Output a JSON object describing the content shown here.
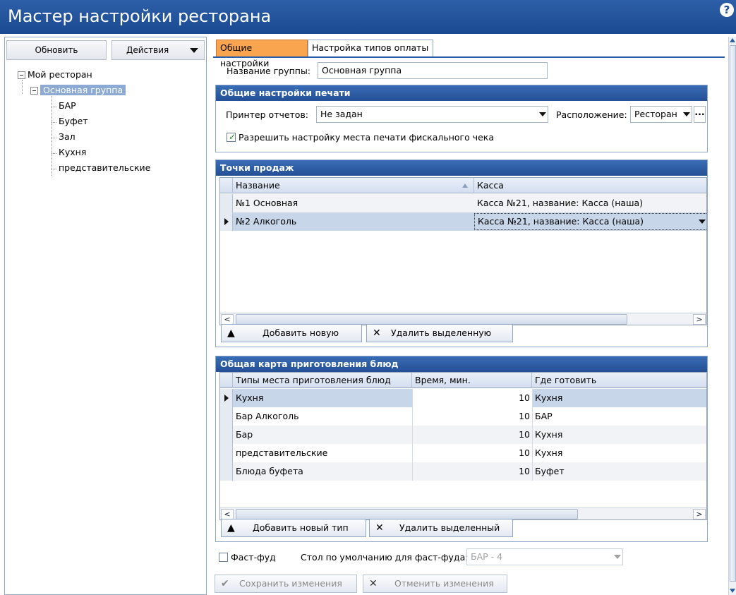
{
  "window": {
    "title": "Мастер настройки ресторана"
  },
  "toolbar": {
    "refresh_label": "Обновить",
    "actions_label": "Действия"
  },
  "tree": {
    "root": "Мой ресторан",
    "group": "Основная группа",
    "children": [
      "БАР",
      "Буфет",
      "Зал",
      "Кухня",
      "представительские"
    ]
  },
  "tabs": [
    {
      "label": "Общие настройки"
    },
    {
      "label": "Настройка типов оплаты"
    }
  ],
  "group_name": {
    "label": "Название группы:",
    "value": "Основная группа"
  },
  "print_settings": {
    "header": "Общие настройки печати",
    "printer_label": "Принтер отчетов:",
    "printer_value": "Не задан",
    "location_label": "Расположение:",
    "location_value": "Ресторан",
    "allow_fiscal_label": "Разрешить настройку места печати фискального чека",
    "allow_fiscal_checked": true
  },
  "points_of_sale": {
    "header": "Точки продаж",
    "columns": [
      "Название",
      "Касса"
    ],
    "rows": [
      {
        "name": "№1 Основная",
        "cash": "Касса №21, название: Касса (наша)"
      },
      {
        "name": "№2 Алкоголь",
        "cash": "Касса №21, название: Касса (наша)"
      }
    ],
    "add_label": "Добавить новую",
    "delete_label": "Удалить выделенную"
  },
  "cooking_map": {
    "header": "Общая карта приготовления блюд",
    "columns": [
      "Типы места приготовления блюд",
      "Время, мин.",
      "Где готовить"
    ],
    "rows": [
      {
        "type": "Кухня",
        "time": "10",
        "where": "Кухня"
      },
      {
        "type": "Бар Алкоголь",
        "time": "10",
        "where": "БАР"
      },
      {
        "type": "Бар",
        "time": "10",
        "where": "Кухня"
      },
      {
        "type": "представительские",
        "time": "10",
        "where": "Кухня"
      },
      {
        "type": "Блюда буфета",
        "time": "10",
        "where": "Буфет"
      }
    ],
    "add_label": "Добавить новый тип",
    "delete_label": "Удалить выделенный"
  },
  "fastfood": {
    "label": "Фаст-фуд",
    "checked": false,
    "default_table_label": "Стол по умолчанию для фаст-фуда:",
    "default_table_value": "БАР - 4"
  },
  "footer": {
    "save_label": "Сохранить изменения",
    "cancel_label": "Отменить изменения"
  },
  "colors": {
    "titlebar": "#2d5fa8",
    "active_tab": "#f9a54f",
    "selection": "#8caad3"
  }
}
